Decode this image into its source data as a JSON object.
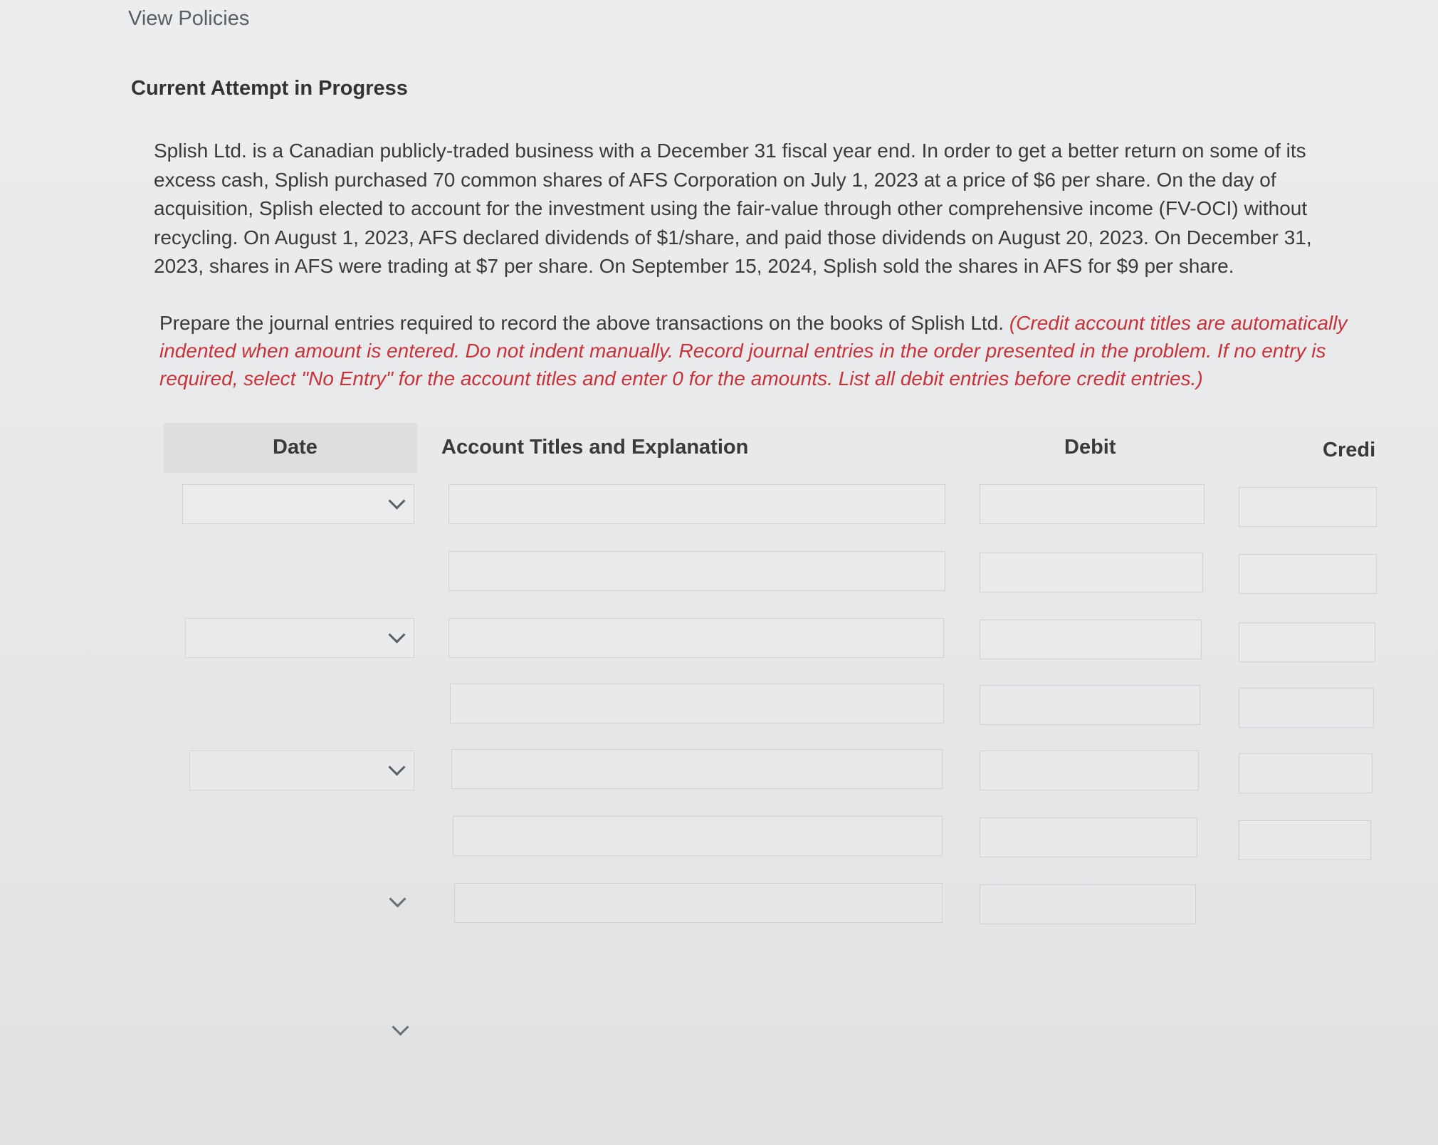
{
  "header": {
    "view_policies": "View Policies",
    "attempt_title": "Current Attempt in Progress"
  },
  "problem": {
    "text": "Splish Ltd. is a Canadian publicly-traded business with a December 31 fiscal year end. In order to get a better return on some of its excess cash, Splish purchased 70 common shares of AFS Corporation on July 1, 2023 at a price of $6 per share. On the day of acquisition, Splish elected to account for the investment using the fair-value through other comprehensive income (FV-OCI) without recycling. On August 1, 2023, AFS declared dividends of $1/share, and paid those dividends on August 20, 2023. On December 31, 2023, shares in AFS were trading at $7 per share. On September 15, 2024, Splish sold the shares in AFS for $9 per share."
  },
  "instructions": {
    "normal": "Prepare the journal entries required to record the above transactions on the books of Splish Ltd. ",
    "red": "(Credit account titles are automatically indented when amount is entered. Do not indent manually. Record journal entries in the order presented in the problem. If no entry is required, select \"No Entry\" for the account titles and enter 0 for the amounts. List all debit entries before credit entries.)"
  },
  "table": {
    "headers": {
      "date": "Date",
      "account": "Account Titles and Explanation",
      "debit": "Debit",
      "credit": "Credi"
    },
    "rows": [
      {
        "date": "",
        "account": "",
        "debit": "",
        "credit": ""
      },
      {
        "date": "",
        "account": "",
        "debit": "",
        "credit": ""
      },
      {
        "date": "",
        "account": "",
        "debit": "",
        "credit": ""
      },
      {
        "date": "",
        "account": "",
        "debit": "",
        "credit": ""
      },
      {
        "date": "",
        "account": "",
        "debit": "",
        "credit": ""
      }
    ]
  },
  "icons": {
    "dropdown": "chevron-down-icon"
  }
}
